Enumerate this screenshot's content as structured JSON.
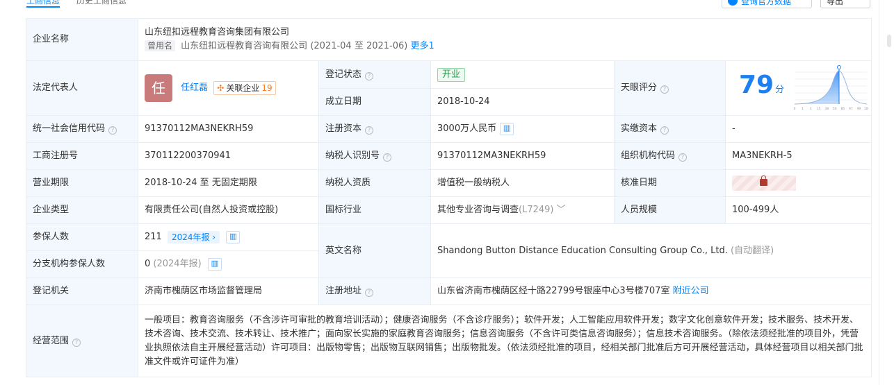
{
  "tabs": [
    "工商信息",
    "历史工商信息"
  ],
  "top_buttons": {
    "b1": "查询官方数据",
    "b2": "导出"
  },
  "company_name": {
    "label": "企业名称",
    "value": "山东纽扣远程教育咨询集团有限公司",
    "used_tag": "曾用名",
    "used_name": "山东纽扣远程教育咨询有限公司",
    "used_period": "(2021-04 至 2021-06)",
    "more": "更多1"
  },
  "legal_rep": {
    "label": "法定代表人",
    "avatar_char": "任",
    "name": "任红磊",
    "related_label": "关联企业",
    "related_count": "19"
  },
  "reg_status": {
    "label": "登记状态",
    "value": "开业"
  },
  "found_date": {
    "label": "成立日期",
    "value": "2018-10-24"
  },
  "tianyan_score": {
    "label": "天眼评分",
    "score": "79",
    "unit": "分",
    "axis_ticks": [
      "0",
      "1",
      "3",
      "15",
      "38",
      "50",
      "85",
      "97",
      "99",
      "100"
    ]
  },
  "credit_code": {
    "label": "统一社会信用代码",
    "value": "91370112MA3NEKRH59"
  },
  "reg_capital": {
    "label": "注册资本",
    "value": "3000万人民币"
  },
  "paid_capital": {
    "label": "实缴资本",
    "value": "-"
  },
  "biz_reg_no": {
    "label": "工商注册号",
    "value": "370112200370941"
  },
  "taxpayer_id": {
    "label": "纳税人识别号",
    "value": "91370112MA3NEKRH59"
  },
  "org_code": {
    "label": "组织机构代码",
    "value": "MA3NEKRH-5"
  },
  "biz_period": {
    "label": "营业期限",
    "value": "2018-10-24 至 无固定期限"
  },
  "taxpayer_qual": {
    "label": "纳税人资质",
    "value": "增值税一般纳税人"
  },
  "approve_date": {
    "label": "核准日期"
  },
  "company_type": {
    "label": "企业类型",
    "value": "有限责任公司(自然人投资或控股)"
  },
  "industry": {
    "label": "国标行业",
    "value": "其他专业咨询与调查",
    "code": "(L7249)"
  },
  "staff_size": {
    "label": "人员规模",
    "value": "100-499人"
  },
  "insured": {
    "label": "参保人数",
    "value": "211",
    "report": "2024年报"
  },
  "branch_insured": {
    "label": "分支机构参保人数",
    "value": "0",
    "report": "(2024年报)"
  },
  "english_name": {
    "label": "英文名称",
    "value": "Shandong Button Distance Education Consulting Group Co., Ltd.",
    "note": "(自动翻译)"
  },
  "reg_authority": {
    "label": "登记机关",
    "value": "济南市槐荫区市场监督管理局"
  },
  "reg_address": {
    "label": "注册地址",
    "value": "山东省济南市槐荫区经十路22799号银座中心3号楼707室",
    "nearby": "附近公司"
  },
  "biz_scope": {
    "label": "经营范围",
    "value": "一般项目：教育咨询服务（不含涉许可审批的教育培训活动）；健康咨询服务（不含诊疗服务）；软件开发；人工智能应用软件开发；数字文化创意软件开发；技术服务、技术开发、技术咨询、技术交流、技术转让、技术推广；面向家长实施的家庭教育咨询服务；信息咨询服务（不含许可类信息咨询服务）；信息技术咨询服务。（除依法须经批准的项目外，凭营业执照依法自主开展经营活动）许可项目：出版物零售；出版物互联网销售；出版物批发。（依法须经批准的项目，经相关部门批准后方可开展经营活动，具体经营项目以相关部门批准文件或许可证件为准）"
  },
  "colors": {
    "accent": "#0084ff",
    "label_bg": "#f3f8fe",
    "border": "#e9eef5",
    "status_green": "#1e9e4a",
    "score_blue": "#1e7ff0"
  }
}
